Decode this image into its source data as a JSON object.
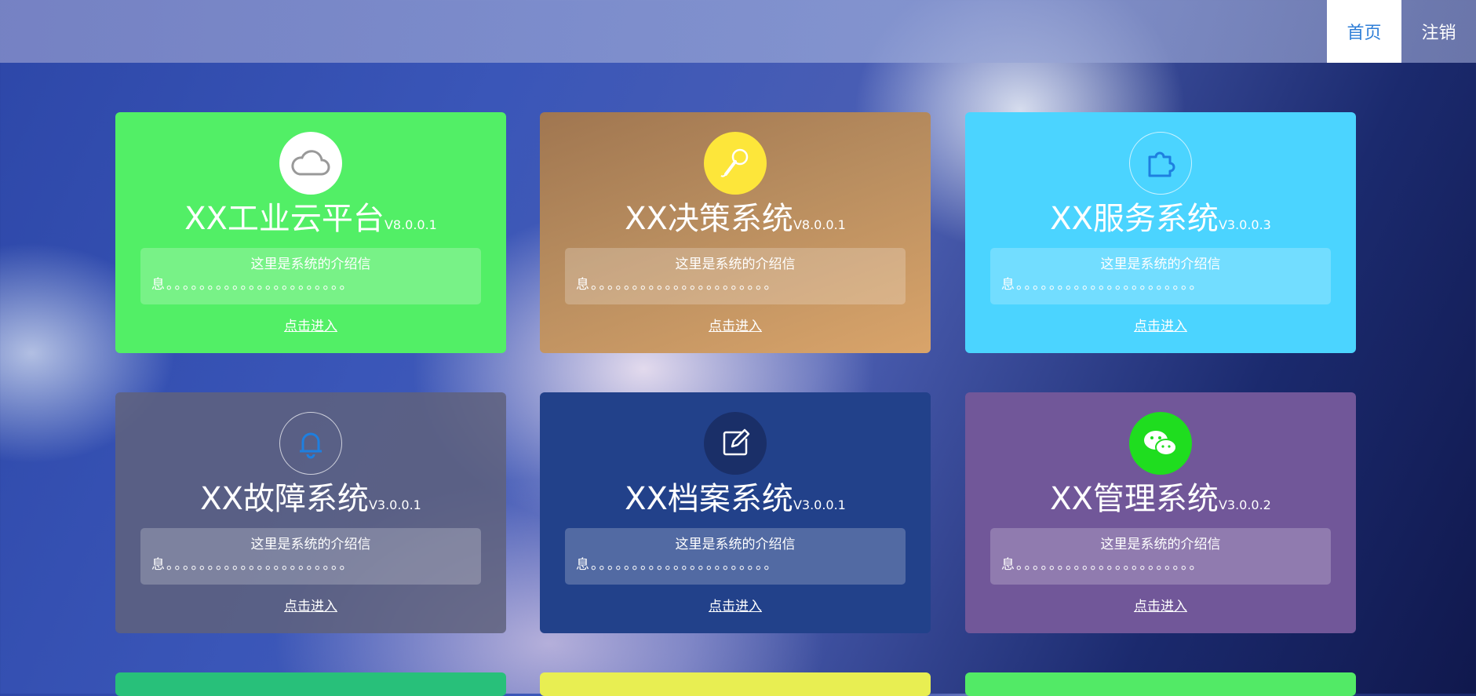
{
  "nav": {
    "home": "首页",
    "logout": "注销"
  },
  "cards": [
    {
      "name": "XX工业云平台",
      "version": "V8.0.0.1",
      "intro_line1": "这里是系统的介绍信",
      "intro_line2": "息。。。。。。。。。。。。。。。。。。。。。。",
      "enter": "点击进入"
    },
    {
      "name": "XX决策系统",
      "version": "V8.0.0.1",
      "intro_line1": "这里是系统的介绍信",
      "intro_line2": "息。。。。。。。。。。。。。。。。。。。。。。",
      "enter": "点击进入"
    },
    {
      "name": "XX服务系统",
      "version": "V3.0.0.3",
      "intro_line1": "这里是系统的介绍信",
      "intro_line2": "息。。。。。。。。。。。。。。。。。。。。。。",
      "enter": "点击进入"
    },
    {
      "name": "XX故障系统",
      "version": "V3.0.0.1",
      "intro_line1": "这里是系统的介绍信",
      "intro_line2": "息。。。。。。。。。。。。。。。。。。。。。。",
      "enter": "点击进入"
    },
    {
      "name": "XX档案系统",
      "version": "V3.0.0.1",
      "intro_line1": "这里是系统的介绍信",
      "intro_line2": "息。。。。。。。。。。。。。。。。。。。。。。",
      "enter": "点击进入"
    },
    {
      "name": "XX管理系统",
      "version": "V3.0.0.2",
      "intro_line1": "这里是系统的介绍信",
      "intro_line2": "息。。。。。。。。。。。。。。。。。。。。。。",
      "enter": "点击进入"
    }
  ],
  "colors": {
    "card1": "#52ef66",
    "card2": "#b98a5a",
    "card3": "#4bd4ff",
    "card4": "#6a6c86",
    "card5": "#22418a",
    "card6": "#715799",
    "card7": "#28c07a",
    "card8": "#e8ee52",
    "card9": "#52ea66",
    "nav_active_text": "#2f7fd8"
  },
  "icons": [
    "cloud-icon",
    "microphone-icon",
    "puzzle-icon",
    "bell-icon",
    "edit-icon",
    "wechat-icon"
  ]
}
